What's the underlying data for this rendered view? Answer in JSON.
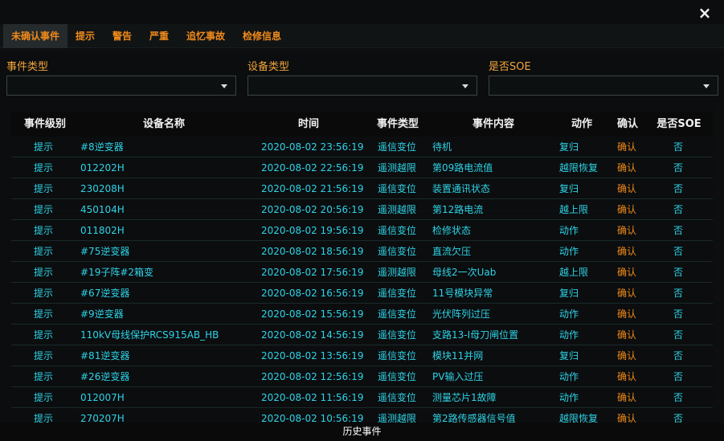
{
  "close_label": "×",
  "tabs": [
    {
      "label": "未确认事件",
      "active": true
    },
    {
      "label": "提示"
    },
    {
      "label": "警告"
    },
    {
      "label": "严重"
    },
    {
      "label": "追忆事故"
    },
    {
      "label": "检修信息"
    }
  ],
  "filters": [
    {
      "label": "事件类型",
      "value": ""
    },
    {
      "label": "设备类型",
      "value": ""
    },
    {
      "label": "是否SOE",
      "value": ""
    }
  ],
  "table": {
    "columns": [
      "事件级别",
      "设备名称",
      "时间",
      "事件类型",
      "事件内容",
      "动作",
      "确认",
      "是否SOE"
    ],
    "rows": [
      [
        "提示",
        "#8逆变器",
        "2020-08-02 23:56:19",
        "遥信变位",
        "待机",
        "复归",
        "确认",
        "否"
      ],
      [
        "提示",
        "012202H",
        "2020-08-02 22:56:19",
        "遥测越限",
        "第09路电流值",
        "越限恢复",
        "确认",
        "否"
      ],
      [
        "提示",
        "230208H",
        "2020-08-02 21:56:19",
        "遥信变位",
        "装置通讯状态",
        "复归",
        "确认",
        "否"
      ],
      [
        "提示",
        "450104H",
        "2020-08-02 20:56:19",
        "遥测越限",
        "第12路电流",
        "越上限",
        "确认",
        "否"
      ],
      [
        "提示",
        "011802H",
        "2020-08-02 19:56:19",
        "遥信变位",
        "检修状态",
        "动作",
        "确认",
        "否"
      ],
      [
        "提示",
        "#75逆变器",
        "2020-08-02 18:56:19",
        "遥信变位",
        "直流欠压",
        "动作",
        "确认",
        "否"
      ],
      [
        "提示",
        "#19子阵#2箱变",
        "2020-08-02 17:56:19",
        "遥测越限",
        "母线2一次Uab",
        "越上限",
        "确认",
        "否"
      ],
      [
        "提示",
        "#67逆变器",
        "2020-08-02 16:56:19",
        "遥信变位",
        "11号模块异常",
        "复归",
        "确认",
        "否"
      ],
      [
        "提示",
        "#9逆变器",
        "2020-08-02 15:56:19",
        "遥信变位",
        "光伏阵列过压",
        "动作",
        "确认",
        "否"
      ],
      [
        "提示",
        "110kV母线保护RCS915AB_HB",
        "2020-08-02 14:56:19",
        "遥信变位",
        "支路13-I母刀闸位置",
        "动作",
        "确认",
        "否"
      ],
      [
        "提示",
        "#81逆变器",
        "2020-08-02 13:56:19",
        "遥信变位",
        "模块11并网",
        "复归",
        "确认",
        "否"
      ],
      [
        "提示",
        "#26逆变器",
        "2020-08-02 12:56:19",
        "遥信变位",
        "PV输入过压",
        "动作",
        "确认",
        "否"
      ],
      [
        "提示",
        "012007H",
        "2020-08-02 11:56:19",
        "遥信变位",
        "测量芯片1故障",
        "动作",
        "确认",
        "否"
      ],
      [
        "提示",
        "270207H",
        "2020-08-02 10:56:19",
        "遥测越限",
        "第2路传感器信号值",
        "越限恢复",
        "确认",
        "否"
      ]
    ]
  },
  "footer": {
    "label": "历史事件"
  },
  "colors": {
    "accent": "#f08a1a",
    "label": "#f2a53a",
    "cell": "#2fd3e6",
    "header_text": "#f2f2f2",
    "background": "#0b0d0e"
  }
}
